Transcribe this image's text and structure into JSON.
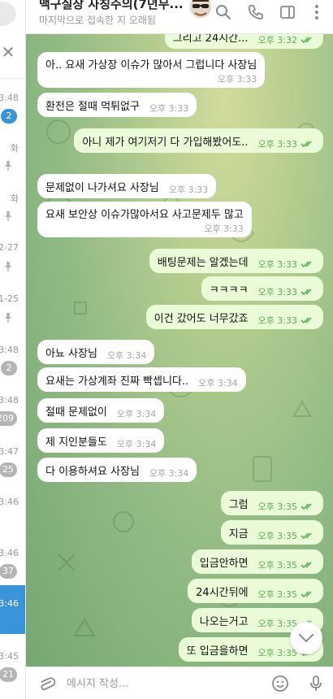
{
  "sidebar": {
    "rows": [
      {
        "time": "3:48",
        "badge": "2",
        "badge_color": "#3a94d9",
        "pinned": false,
        "active": false
      },
      {
        "time": "화",
        "badge": "",
        "pinned": true,
        "active": false
      },
      {
        "time": "화",
        "badge": "",
        "pinned": true,
        "active": false
      },
      {
        "time": "2-27",
        "badge": "",
        "pinned": true,
        "active": false
      },
      {
        "time": "1-25",
        "badge": "",
        "pinned": true,
        "active": false
      },
      {
        "time": "3:48",
        "badge": "2",
        "badge_color": "#b5b5b5",
        "pinned": false,
        "active": false
      },
      {
        "time": "3:48",
        "badge": "209",
        "badge_color": "#b5b5b5",
        "pinned": false,
        "active": false
      },
      {
        "time": "3:47",
        "badge": "25",
        "badge_color": "#b5b5b5",
        "pinned": false,
        "active": false
      },
      {
        "time": "3:46",
        "badge": "",
        "pinned": false,
        "active": false
      },
      {
        "time": "3:46",
        "badge": "37",
        "badge_color": "#b5b5b5",
        "pinned": false,
        "active": false
      },
      {
        "time": "3:46",
        "badge": "",
        "pinned": false,
        "active": true
      },
      {
        "time": "3:45",
        "badge": "21",
        "badge_color": "#b5b5b5",
        "pinned": false,
        "active": false
      }
    ],
    "close_glyph": "✕"
  },
  "header": {
    "title": "맥구실장 사칭주의(7년무...",
    "status": "마지막으로 접속한 지 오래됨",
    "icons": [
      "search-icon",
      "phone-icon",
      "sidebar-toggle-icon",
      "more-vertical-icon"
    ]
  },
  "messages": [
    {
      "dir": "out",
      "text": "그리고 24시간...",
      "time": "오후 3:32",
      "read": true
    },
    {
      "dir": "in",
      "text": "아.. 요새 가상장 이슈가 많아서 그럽니다 사장님",
      "time": "오후 3:33"
    },
    {
      "dir": "in",
      "text": "환전은 절때 먹튀없구",
      "time": "오후 3:33"
    },
    {
      "dir": "out",
      "text": "아니 제가 여기저기 다 가입해봤어도..",
      "time": "오후 3:33",
      "read": true
    },
    {
      "dir": "in",
      "text": "문제없이 나가셔요 사장님",
      "time": "오후 3:33"
    },
    {
      "dir": "in",
      "text": "요새 보안상 이슈가많아서요 사고문제두 많고",
      "time": "오후 3:33"
    },
    {
      "dir": "out",
      "text": "배팅문제는 알겠는데",
      "time": "오후 3:33",
      "read": true
    },
    {
      "dir": "out",
      "text": "ㅋㅋㅋㅋ",
      "time": "오후 3:33",
      "read": true
    },
    {
      "dir": "out",
      "text": "이건 갔어도 너무갔죠",
      "time": "오후 3:33",
      "read": true
    },
    {
      "dir": "in",
      "text": "아뇨 사장님",
      "time": "오후 3:34"
    },
    {
      "dir": "in",
      "text": "요새는 가상계좌 진짜 빡셉니다..",
      "time": "오후 3:34"
    },
    {
      "dir": "in",
      "text": "절때 문제없이",
      "time": "오후 3:34"
    },
    {
      "dir": "in",
      "text": "제 지인분들도",
      "time": "오후 3:34"
    },
    {
      "dir": "in",
      "text": "다 이용하셔요 사장님",
      "time": "오후 3:34"
    },
    {
      "dir": "out",
      "text": "그럼",
      "time": "오후 3:35",
      "read": true
    },
    {
      "dir": "out",
      "text": "지금",
      "time": "오후 3:35",
      "read": true
    },
    {
      "dir": "out",
      "text": "입금안하면",
      "time": "오후 3:35",
      "read": true
    },
    {
      "dir": "out",
      "text": "24시간뒤에",
      "time": "오후 3:35",
      "read": true
    },
    {
      "dir": "out",
      "text": "나오는거고",
      "time": "오후 3:35",
      "read": true
    },
    {
      "dir": "out",
      "text": "또 입금을하면",
      "time": "오후 3:35",
      "read": true
    }
  ],
  "composer": {
    "placeholder": "메시지 작성..."
  },
  "colors": {
    "accent": "#3a94d9",
    "outgoing_bubble": "#e9fcd7",
    "incoming_bubble": "#ffffff",
    "read_check": "#5cae5a"
  }
}
